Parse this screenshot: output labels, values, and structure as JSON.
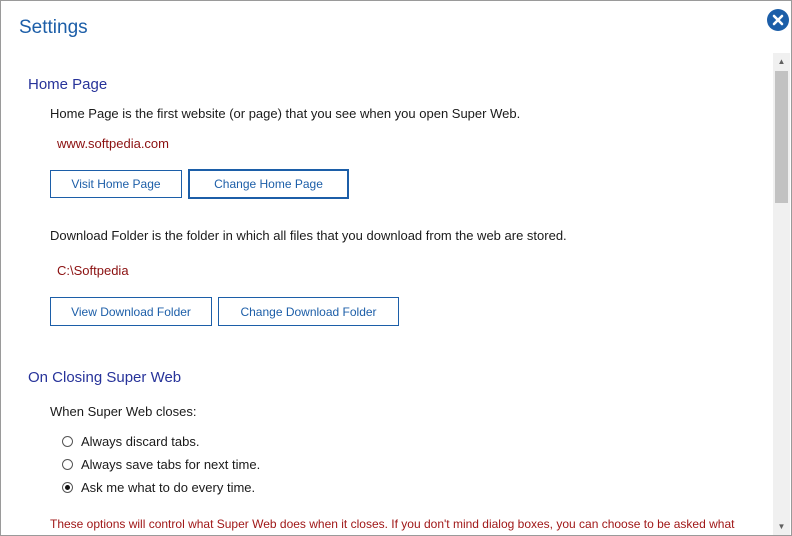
{
  "window": {
    "title": "Settings",
    "close_icon": "close-circle-icon"
  },
  "home_page": {
    "section_title": "Home Page",
    "description": "Home Page is the first website (or page) that you see when you open Super Web.",
    "value": "www.softpedia.com",
    "visit_button": "Visit Home Page",
    "change_button": "Change Home Page"
  },
  "download_folder": {
    "description": "Download Folder is the folder in which all files that you download from the web are stored.",
    "value": "C:\\Softpedia",
    "view_button": "View Download Folder",
    "change_button": "Change Download Folder"
  },
  "on_closing": {
    "section_title": "On Closing Super Web",
    "prompt": "When Super Web closes:",
    "options": [
      {
        "label": "Always discard tabs.",
        "checked": false
      },
      {
        "label": "Always save tabs for next time.",
        "checked": false
      },
      {
        "label": "Ask me what to do every time.",
        "checked": true
      }
    ],
    "note": "These options will control what Super Web  does when it closes. If you don't mind dialog boxes, you can choose to be asked what"
  },
  "colors": {
    "accent": "#1c5ea8",
    "section_title": "#27339a",
    "value_text": "#8b1010",
    "note_text": "#a01818"
  }
}
